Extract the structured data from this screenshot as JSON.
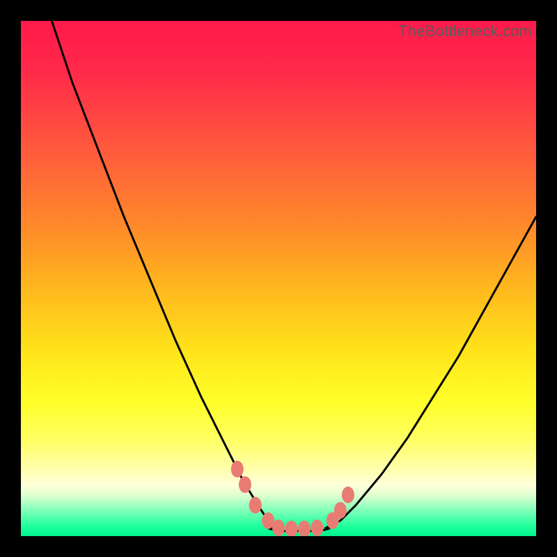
{
  "watermark": "TheBottleneck.com",
  "colors": {
    "frame_bg": "#000000",
    "marker": "#e97c72",
    "curve": "#000000"
  },
  "chart_data": {
    "type": "line",
    "title": "",
    "xlabel": "",
    "ylabel": "",
    "xlim": [
      0,
      100
    ],
    "ylim": [
      0,
      100
    ],
    "grid": false,
    "curve_left": {
      "x": [
        6,
        10,
        15,
        20,
        25,
        30,
        35,
        40,
        43,
        46,
        48,
        50
      ],
      "y": [
        100,
        88,
        75,
        62,
        50,
        38,
        27,
        17,
        11,
        6,
        3,
        1.5
      ]
    },
    "curve_right": {
      "x": [
        59,
        62,
        65,
        70,
        75,
        80,
        85,
        90,
        95,
        100
      ],
      "y": [
        1.5,
        3,
        6,
        12,
        19,
        27,
        35,
        44,
        53,
        62
      ]
    },
    "floor": {
      "x": [
        48,
        50,
        52,
        55,
        58,
        60
      ],
      "y": [
        1.5,
        1,
        1,
        1,
        1,
        1.5
      ]
    },
    "markers": [
      {
        "x": 42,
        "y": 13
      },
      {
        "x": 43.5,
        "y": 10
      },
      {
        "x": 45.5,
        "y": 6
      },
      {
        "x": 48,
        "y": 3
      },
      {
        "x": 50,
        "y": 1.6
      },
      {
        "x": 52.5,
        "y": 1.4
      },
      {
        "x": 55,
        "y": 1.4
      },
      {
        "x": 57.5,
        "y": 1.6
      },
      {
        "x": 60.5,
        "y": 3
      },
      {
        "x": 62,
        "y": 5
      },
      {
        "x": 63.5,
        "y": 8
      }
    ],
    "gradient_bands_approx": [
      {
        "pct_from_top": 0,
        "color": "#ff1a4a"
      },
      {
        "pct_from_top": 25,
        "color": "#ff5a3c"
      },
      {
        "pct_from_top": 50,
        "color": "#ffb81e"
      },
      {
        "pct_from_top": 75,
        "color": "#ffff2a"
      },
      {
        "pct_from_top": 90,
        "color": "#ffffd8"
      },
      {
        "pct_from_top": 100,
        "color": "#00f58c"
      }
    ]
  }
}
